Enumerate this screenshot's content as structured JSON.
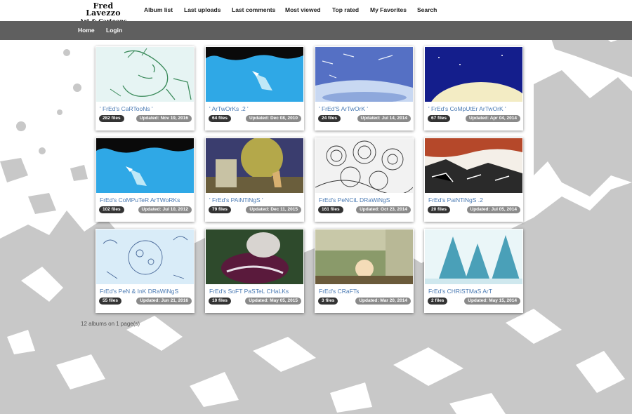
{
  "site": {
    "title_line1": "Fred Lavezzo",
    "title_line2": "Art & Cartoons"
  },
  "top_nav": [
    {
      "label": "Album list"
    },
    {
      "label": "Last uploads"
    },
    {
      "label": "Last comments"
    },
    {
      "label": "Most viewed"
    },
    {
      "label": "Top rated"
    },
    {
      "label": "My Favorites"
    },
    {
      "label": "Search"
    }
  ],
  "sub_nav": [
    {
      "label": "Home"
    },
    {
      "label": "Login"
    }
  ],
  "albums": [
    {
      "title": "' FrEd's CaRTooNs '",
      "files": "282 files",
      "updated": "Updated: Nov 19, 2016"
    },
    {
      "title": "' ArTwOrKs .2 '",
      "files": "64 files",
      "updated": "Updated: Dec 08, 2010"
    },
    {
      "title": "' FrEd'S ArTwOrK '",
      "files": "24 files",
      "updated": "Updated: Jul 14, 2014"
    },
    {
      "title": "' FrEd's CoMpUtEr ArTwOrK '",
      "files": "67 files",
      "updated": "Updated: Apr 04, 2014"
    },
    {
      "title": "FrEd's CoMPuTeR ArTWoRKs",
      "files": "102 files",
      "updated": "Updated: Jul 10, 2012"
    },
    {
      "title": "' FrEd's PAiNTiNgS '",
      "files": "79 files",
      "updated": "Updated: Dec 11, 2015"
    },
    {
      "title": "FrEd's PeNCiL DRaWiNgS",
      "files": "161 files",
      "updated": "Updated: Oct 23, 2014"
    },
    {
      "title": "FrEd's PaiNTiNgS .2",
      "files": "20 files",
      "updated": "Updated: Jul 05, 2014"
    },
    {
      "title": "FrEd's PeN & InK DRaWiNgS",
      "files": "55 files",
      "updated": "Updated: Jun 21, 2016"
    },
    {
      "title": "FrEd's SoFT PaSTeL CHaLKs",
      "files": "10 files",
      "updated": "Updated: May 05, 2015"
    },
    {
      "title": "FrEd's CRaFTs",
      "files": "3 files",
      "updated": "Updated: Mar 20, 2014"
    },
    {
      "title": "FrEd's CHRiSTMaS ArT",
      "files": "2 files",
      "updated": "Updated: May 15, 2014"
    }
  ],
  "footer": {
    "count_text": "12 albums on 1 page(s)"
  },
  "colors": {
    "subnav_bg": "#5f5f5f",
    "link_blue": "#4a7ab3",
    "files_badge": "#333333",
    "updated_badge": "#8a8a8a"
  }
}
